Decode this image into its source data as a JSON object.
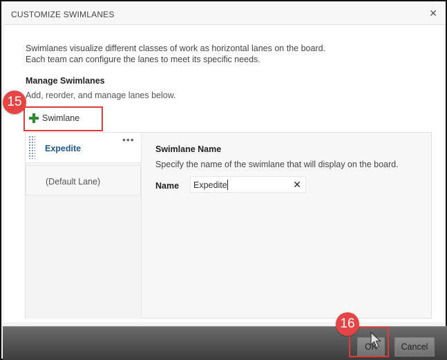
{
  "dialog": {
    "title": "CUSTOMIZE SWIMLANES",
    "close_icon": "close-icon",
    "description_line1": "Swimlanes visualize different classes of work as horizontal lanes on the board.",
    "description_line2": "Each team can configure the lanes to meet its specific needs."
  },
  "manage": {
    "heading": "Manage Swimlanes",
    "subtext": "Add, reorder, and manage lanes below.",
    "add_button_label": "Swimlane",
    "add_icon": "plus-icon"
  },
  "annotations": {
    "badge_add": "15",
    "badge_ok": "16",
    "highlight_color": "#e03a3a"
  },
  "lanes": [
    {
      "label": "Expedite",
      "selected": true
    },
    {
      "label": "(Default Lane)",
      "selected": false
    }
  ],
  "more_icon": "ellipsis-icon",
  "detail": {
    "heading": "Swimlane Name",
    "description": "Specify the name of the swimlane that will display on the board.",
    "name_label": "Name",
    "name_value": "Expedite",
    "clear_icon": "clear-icon"
  },
  "footer": {
    "ok_label": "OK",
    "cancel_label": "Cancel"
  },
  "colors": {
    "selected_lane_text": "#1f5a96",
    "add_icon": "#2e8b2e",
    "badge": "#e64545"
  }
}
